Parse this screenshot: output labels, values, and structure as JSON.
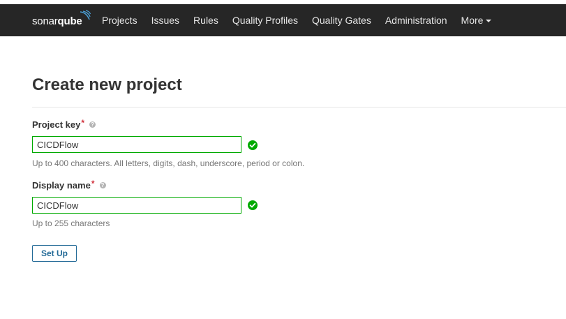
{
  "brand": {
    "logo_light": "sonar",
    "logo_bold": "qube"
  },
  "nav": {
    "items": [
      {
        "label": "Projects"
      },
      {
        "label": "Issues"
      },
      {
        "label": "Rules"
      },
      {
        "label": "Quality Profiles"
      },
      {
        "label": "Quality Gates"
      },
      {
        "label": "Administration"
      },
      {
        "label": "More"
      }
    ]
  },
  "page": {
    "title": "Create new project"
  },
  "form": {
    "project_key": {
      "label": "Project key",
      "required_mark": "*",
      "value": "CICDFlow",
      "hint": "Up to 400 characters. All letters, digits, dash, underscore, period or colon."
    },
    "display_name": {
      "label": "Display name",
      "required_mark": "*",
      "value": "CICDFlow",
      "hint": "Up to 255 characters"
    },
    "submit_label": "Set Up"
  },
  "colors": {
    "navbar_bg": "#262626",
    "valid_green": "#00aa00",
    "button_blue": "#236a97",
    "required_red": "#d02f3a"
  },
  "icons": {
    "help": "question-circle-icon",
    "valid": "check-circle-icon",
    "more_menu": "caret-down-icon"
  }
}
